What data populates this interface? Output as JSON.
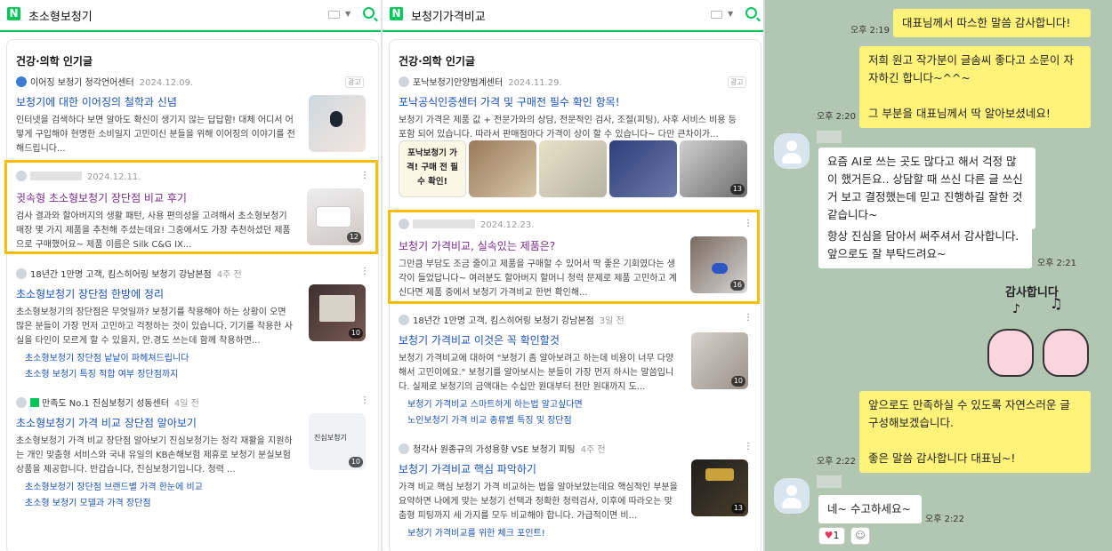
{
  "left": {
    "query": "초소형보청기",
    "section": "건강·의학 인기글",
    "ad_label": "광고",
    "results": [
      {
        "source": "이어징 보청기 청각언어센터",
        "date": "2024.12.09.",
        "title": "보청기에 대한 이어징의 철학과 신념",
        "desc": "인터넷을 검색하다 보면 알아도 확신이 생기지 않는 답답함! 대체 어디서 어떻게 구입해야 현명한 소비일지 고민이신 분들을 위해 이어징의 이야기를 전해드립니다..."
      },
      {
        "date": "2024.12.11.",
        "title": "귓속형 초소형보청기 장단점 비교 후기",
        "desc": "검사 결과와 할아버지의 생활 패턴, 사용 편의성을 고려해서 초소형보청기 매장 몇 가지 제품을 추천해 주셨는데요! 그중에서도 가장 추천하셨던 제품으로 구매했어요~ 제품 이름은 Silk C&G IX...",
        "count": "12"
      },
      {
        "source": "18년간 1만명 고객, 킴스히어링 보청기 강남본점",
        "date": "4주 전",
        "title": "초소형보청기 장단점 한방에 정리",
        "desc": "초소형보청기의 장단점은 무엇일까? 보청기를 착용해야 하는 상황이 오면 많은 분들이 가장 먼저 고민하고 걱정하는 것이 있습니다. 기기를 착용한 사실을 타인이 모르게 할 수 있을지, 안.경도 쓰는데 함께 착용하면...",
        "count": "10",
        "sub": [
          "초소형보청기 장단점 낱낱이 파헤쳐드립니다",
          "초소형 보청기 특징 적합 여부 장단점까지"
        ]
      },
      {
        "source": "만족도 No.1 진심보청기 성동센터",
        "date": "4일 전",
        "title": "초소형보청기 가격 비교 장단점 알아보기",
        "desc": "초소형보청기 가격 비교 장단점 알아보기 진심보청기는 청각 재활을 지원하는 개인 맞춤형 서비스와 국내 유일의 KB손해보험 제휴로 보청기 분실보험 상품을 제공합니다. 반갑습니다, 진심보청기입니다. 청력 ...",
        "count": "10",
        "thumb_text": "진심보청기",
        "sub": [
          "초소형보청기 장단점 브랜드별 가격 한눈에 비교",
          "초소형 보청기 모델과 가격 장단점"
        ]
      }
    ]
  },
  "middle": {
    "query": "보청기가격비교",
    "section": "건강·의학 인기글",
    "ad_label": "광고",
    "results": [
      {
        "source": "포낙보청기안양범계센터",
        "date": "2024.11.29.",
        "title": "포낙공식인증센터 가격 및 구매전 필수 확인 항목!",
        "desc": "보청기 가격은 제품 값 + 전문가와의 상담, 전문적인 검사, 조절(피팅), 사후 서비스 비용 등 포함 되어 있습니다. 따라서 판매점마다 가격이 상이 할 수 있습니다~ 다만 큰차이가...",
        "thumb_text": "포낙보청기 가격! 구매 전 필수 확인!",
        "count": "13"
      },
      {
        "date": "2024.12.23.",
        "title": "보청기 가격비교, 실속있는 제품은?",
        "desc": "그만큼 부담도 조금 줄이고 제품을 구매할 수 있어서 딱 좋은 기회였다는 생각이 들었답니다~ 여러분도 할아버지 할머니 청력 문제로 제품 고민하고 계신다면 제품 중에서 보청기 가격비교 한번 확인해...",
        "count": "16"
      },
      {
        "source": "18년간 1만명 고객, 킴스히어링 보청기 강남본점",
        "date": "3일 전",
        "title": "보청기 가격비교 이것은 꼭 확인할것",
        "desc": "보청기 가격비교에 대하여 \"보청기 좀 알아보려고 하는데 비용이 너무 다양해서 고민이에요.\" 보청기를 알아보시는 분들이 가장 먼저 하시는 말씀입니다. 실제로 보청기의 금액대는 수십만 원대부터 천만 원대까지 도...",
        "count": "10",
        "sub": [
          "보청기 가격비교 스마트하게 하는법 알고싶다면",
          "노인보청기 가격 비교 종류별 특징 및 장단점"
        ]
      },
      {
        "source": "청각사 원종규의 가성용향 VSE 보청기 피팅",
        "date": "4주 전",
        "title": "보청기 가격비교 핵심 파악하기",
        "desc": "가격 비교 핵심 보청기 가격 비교하는 법을 알아보았는데요 핵심적인 부분을 요약하면 나에게 맞는 보청기 선택과 정확한 청력검사, 이후에 따라오는 맞춤형 피팅까지 세 가지를 모두 비교해야 합니다. 가급적이면 비...",
        "count": "13",
        "sub": [
          "보청기 가격비교를 위한 체크 포인트!"
        ]
      }
    ]
  },
  "chat": {
    "messages": [
      {
        "text": "대표님께서 따스한 말씀 감사합니다!",
        "time": "오후 2:19"
      },
      {
        "text": "저희 원고 작가분이 글솜씨 좋다고 소문이 자자하긴 합니다~^^~\n\n그 부분을 대표님께서 딱 알아보셨네요!",
        "time": "오후 2:20"
      },
      {
        "text": "요즘 AI로 쓰는 곳도 많다고 해서 걱정 많이 했거든요.. 상담할 때 쓰신 다른 글 쓰신거 보고 결정했는데 믿고 진행하길 잘한 것 같습니다~"
      },
      {
        "text": "항상 진심을 담아서 써주셔서 감사합니다. 앞으로도 잘 부탁드려요~",
        "time": "오후 2:21"
      },
      {
        "text": "앞으로도 만족하실 수 있도록 자연스러운 글 구성해보겠습니다.\n\n좋은 말씀 감사합니다 대표님~!",
        "time": "오후 2:22"
      },
      {
        "text": "네~ 수고하세요~",
        "time": "오후 2:22"
      }
    ],
    "sticker_text": "감사합니다",
    "reaction_count": "1"
  },
  "colors": {
    "naver_green": "#03c75a",
    "highlight": "#f5c000",
    "chat_bg": "#b2c7b1",
    "my_bubble": "#fff37a"
  }
}
